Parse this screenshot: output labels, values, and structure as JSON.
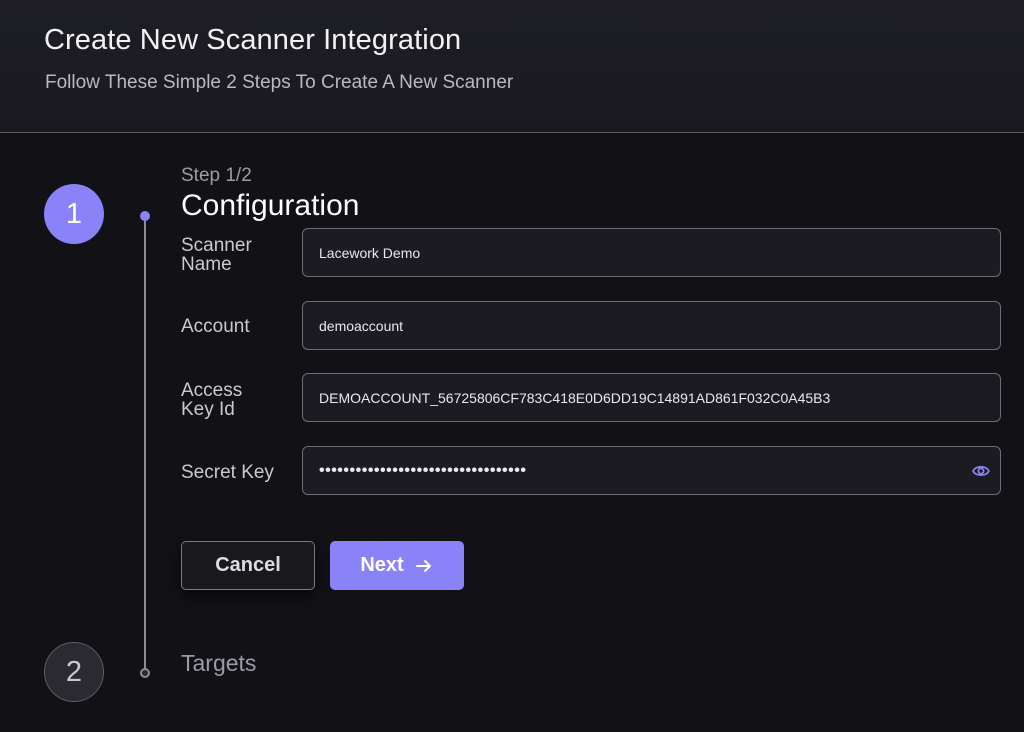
{
  "header": {
    "title": "Create New Scanner Integration",
    "subtitle": "Follow These Simple 2 Steps To Create A New Scanner"
  },
  "steps": [
    {
      "number": "1",
      "state": "active"
    },
    {
      "number": "2",
      "state": "inactive",
      "title": "Targets"
    }
  ],
  "current_step": {
    "label": "Step 1/2",
    "title": "Configuration"
  },
  "form": {
    "scanner_name": {
      "label_line1": "Scanner",
      "label_line2": "Name",
      "value": "Lacework Demo"
    },
    "account": {
      "label": "Account",
      "value": "demoaccount"
    },
    "access_key_id": {
      "label_line1": "Access",
      "label_line2": "Key Id",
      "value": "DEMOACCOUNT_56725806CF783C418E0D6DD19C14891AD861F032C0A45B3"
    },
    "secret_key": {
      "label": "Secret Key",
      "value": "••••••••••••••••••••••••••••••••••",
      "icon": "eye-icon"
    }
  },
  "actions": {
    "cancel_label": "Cancel",
    "next_label": "Next",
    "next_icon": "arrow-right-icon"
  },
  "colors": {
    "accent": "#8a82f7",
    "background": "#111116",
    "header_background": "#1e1e25",
    "input_background": "#1b1b21"
  }
}
